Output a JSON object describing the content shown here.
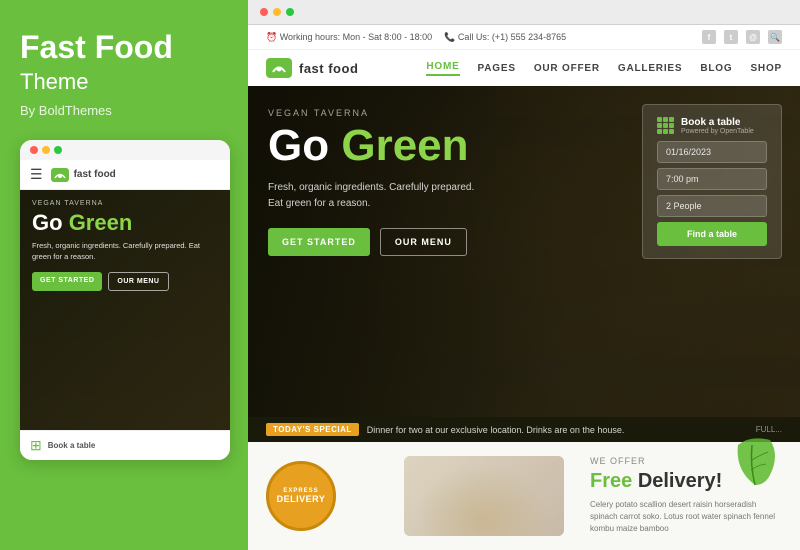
{
  "left": {
    "title": "Fast Food",
    "subtitle": "Theme",
    "by": "By BoldThemes",
    "mobile": {
      "vegan_tag": "VEGAN TAVERNA",
      "headline_go": "Go",
      "headline_green": "Green",
      "description": "Fresh, organic ingredients.\nCarefully prepared.\nEat green for a reason.",
      "btn_start": "GET STARTED",
      "btn_menu": "OUR MENU",
      "book_text": "Book a table",
      "logo_text": "fast food"
    }
  },
  "right": {
    "browser": {
      "dot_colors": [
        "#ff5f57",
        "#febc2e",
        "#28c840"
      ]
    },
    "topbar": {
      "working_hours": "⏰ Working hours: Mon - Sat 8:00 - 18:00",
      "call_us": "📞 Call Us: (+1) 555 234-8765",
      "social": [
        "f",
        "t",
        "@",
        "🔍"
      ]
    },
    "navbar": {
      "logo_text": "fast food",
      "links": [
        "HOME",
        "PAGES",
        "OUR OFFER",
        "GALLERIES",
        "BLOG",
        "SHOP"
      ],
      "active": "HOME"
    },
    "hero": {
      "vegan_tag": "VEGAN TAVERNA",
      "headline_go": "Go",
      "headline_green": "Green",
      "desc_lines": [
        "Fresh, organic ingredients. Carefully prepared.",
        "Eat green for a reason."
      ],
      "btn_start": "GET STARTED",
      "btn_menu": "OUR MENU"
    },
    "book_table": {
      "title": "Book a table",
      "powered": "Powered by OpenTable",
      "date": "01/16/2023",
      "time": "7:00 pm",
      "people": "2 People",
      "btn": "Find a table"
    },
    "todays_special": {
      "label": "TODAY'S SPECIAL",
      "text": "Dinner for two at our exclusive location. Drinks are on the house.",
      "full_link": "FULL..."
    },
    "bottom": {
      "express_label1": "EXPRESS",
      "express_label2": "DELIVERY",
      "we_offer": "WE OFFER",
      "headline_free": "Free",
      "headline_delivery": "Delivery!",
      "description": "Celery potato scallion desert raisin horseradish spinach carrot soko. Lotus root water spinach fennel kombu maize bamboo"
    }
  }
}
